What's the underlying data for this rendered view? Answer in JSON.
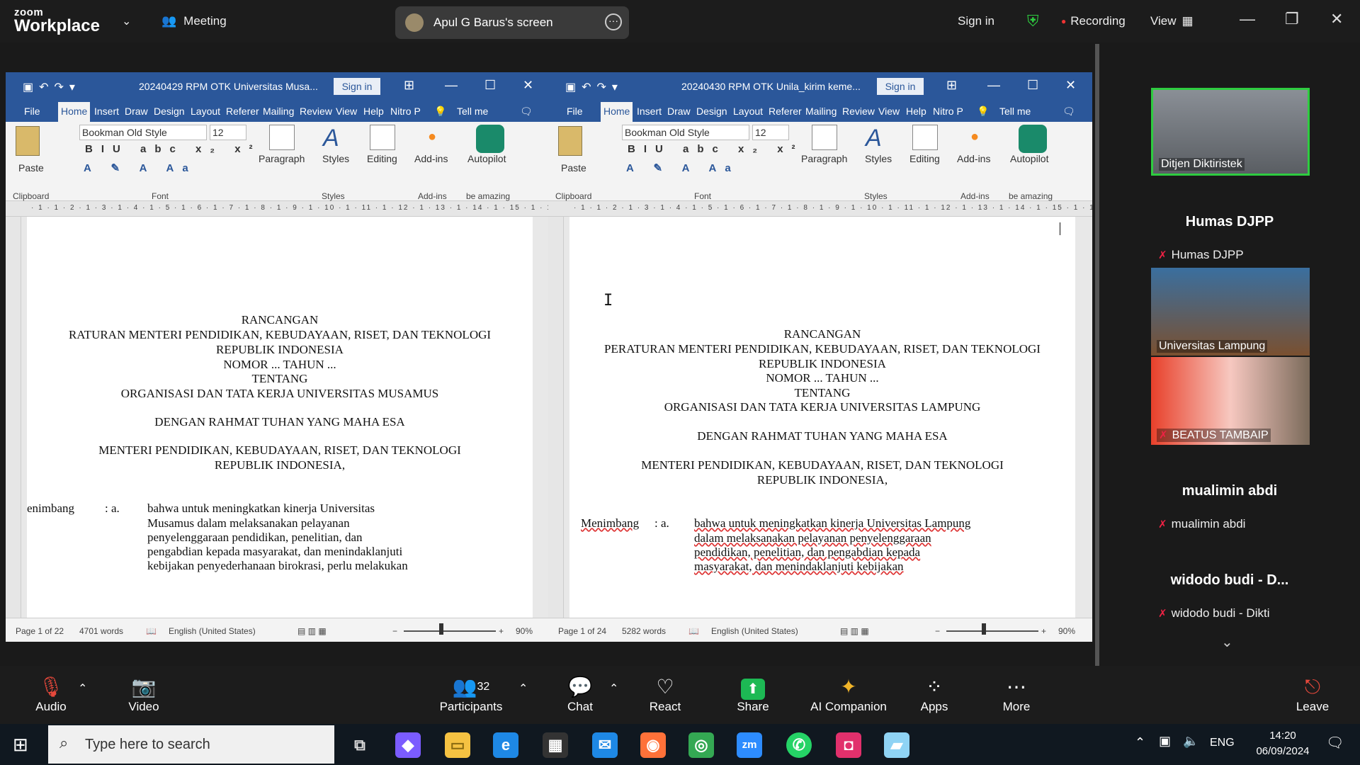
{
  "app": {
    "brand_top": "zoom",
    "brand_bottom": "Workplace"
  },
  "topbar": {
    "meeting": "Meeting",
    "share_label": "Apul G Barus's screen",
    "sign_in": "Sign in",
    "recording": "Recording",
    "view": "View"
  },
  "left_doc": {
    "filename": "20240429 RPM OTK Universitas Musa...",
    "sign_in": "Sign in",
    "tabs": [
      "File",
      "Home",
      "Insert",
      "Draw",
      "Design",
      "Layout",
      "Referer",
      "Mailing",
      "Review",
      "View",
      "Help",
      "Nitro P"
    ],
    "tell_me": "Tell me",
    "font_name": "Bookman Old Style",
    "font_size": "12",
    "groups": {
      "clipboard": "Clipboard",
      "font": "Font",
      "styles": "Styles",
      "addins": "Add-ins",
      "amazing": "be amazing"
    },
    "buttons": {
      "paste": "Paste",
      "paragraph": "Paragraph",
      "styles": "Styles",
      "editing": "Editing",
      "addins": "Add-ins",
      "autopilot": "Autopilot"
    },
    "ruler": "· 1 · 1 · 2 · 1 · 3 · 1 · 4 · 1 · 5 · 1 · 6 · 1 · 7 · 1 · 8 · 1 · 9 · 1 · 10 · 1 · 11 · 1 · 12 · 1 · 13 · 1 · 14 · 1 · 15 · 1 · 16 · 1 · 17 · 1 · 18",
    "lines": [
      "RANCANGAN",
      "RATURAN MENTERI PENDIDIKAN, KEBUDAYAAN, RISET, DAN TEKNOLOGI",
      "REPUBLIK INDONESIA",
      "NOMOR ... TAHUN ...",
      "TENTANG",
      "ORGANISASI DAN TATA KERJA UNIVERSITAS MUSAMUS",
      "DENGAN RAHMAT TUHAN YANG MAHA ESA",
      "MENTERI PENDIDIKAN, KEBUDAYAAN, RISET, DAN TEKNOLOGI",
      "REPUBLIK INDONESIA,"
    ],
    "menimbang": "enimbang",
    "colon_a": ": a.",
    "body": [
      "bahwa untuk meningkatkan kinerja Universitas",
      "Musamus dalam melaksanakan pelayanan",
      "penyelenggaraan pendidikan, penelitian, dan",
      "pengabdian kepada masyarakat, dan menindaklanjuti",
      "kebijakan penyederhanaan birokrasi, perlu melakukan"
    ],
    "status": {
      "page": "Page 1 of 22",
      "words": "4701 words",
      "lang": "English (United States)",
      "zoom": "90%"
    }
  },
  "right_doc": {
    "filename": "20240430 RPM OTK Unila_kirim keme...",
    "sign_in": "Sign in",
    "tabs": [
      "File",
      "Home",
      "Insert",
      "Draw",
      "Design",
      "Layout",
      "Referer",
      "Mailing",
      "Review",
      "View",
      "Help",
      "Nitro P"
    ],
    "tell_me": "Tell me",
    "font_name": "Bookman Old Style",
    "font_size": "12",
    "groups": {
      "clipboard": "Clipboard",
      "font": "Font",
      "styles": "Styles",
      "addins": "Add-ins",
      "amazing": "be amazing"
    },
    "buttons": {
      "paste": "Paste",
      "paragraph": "Paragraph",
      "styles": "Styles",
      "editing": "Editing",
      "addins": "Add-ins",
      "autopilot": "Autopilot"
    },
    "ruler": "· 1 · 1 · 2 · 1 · 3 · 1 · 4 · 1 · 5 · 1 · 6 · 1 · 7 · 1 · 8 · 1 · 9 · 1 · 10 · 1 · 11 · 1 · 12 · 1 · 13 · 1 · 14 · 1 · 15 · 1 · 16 · 1 · 17",
    "lines": [
      "RANCANGAN",
      "PERATURAN MENTERI PENDIDIKAN, KEBUDAYAAN, RISET, DAN TEKNOLOGI",
      "REPUBLIK INDONESIA",
      "NOMOR ... TAHUN ...",
      "TENTANG",
      "ORGANISASI DAN TATA KERJA UNIVERSITAS LAMPUNG",
      "DENGAN RAHMAT TUHAN YANG MAHA ESA",
      "MENTERI PENDIDIKAN, KEBUDAYAAN, RISET, DAN TEKNOLOGI",
      "REPUBLIK INDONESIA,"
    ],
    "menimbang": "Menimbang",
    "colon_a": ": a.",
    "body": [
      "bahwa untuk meningkatkan kinerja Universitas Lampung",
      "dalam melaksanakan pelayanan penyelenggaraan",
      "pendidikan, penelitian, dan pengabdian kepada",
      "masyarakat, dan menindaklanjuti kebijakan"
    ],
    "status": {
      "page": "Page 1 of 24",
      "words": "5282 words",
      "lang": "English (United States)",
      "zoom": "90%"
    }
  },
  "participants": {
    "tile1": "Ditjen Diktiristek",
    "p2_title": "Humas DJPP",
    "p2_sub": "Humas DJPP",
    "tile2": "Universitas Lampung",
    "tile3": "BEATUS TAMBAIP",
    "p4_title": "mualimin abdi",
    "p4_sub": "mualimin abdi",
    "p5_title": "widodo budi - D...",
    "p5_sub": "widodo budi - Dikti"
  },
  "toolbar": {
    "audio": "Audio",
    "video": "Video",
    "participants": "Participants",
    "participants_count": "32",
    "chat": "Chat",
    "react": "React",
    "share": "Share",
    "ai": "AI Companion",
    "apps": "Apps",
    "more": "More",
    "leave": "Leave"
  },
  "taskbar": {
    "search_placeholder": "Type here to search",
    "lang": "ENG",
    "time": "14:20",
    "date": "06/09/2024"
  },
  "colors": {
    "word_blue": "#2b579a",
    "zoom_bg": "#1c1c1c",
    "share_green": "#1db954",
    "muted_red": "#e5483b"
  }
}
